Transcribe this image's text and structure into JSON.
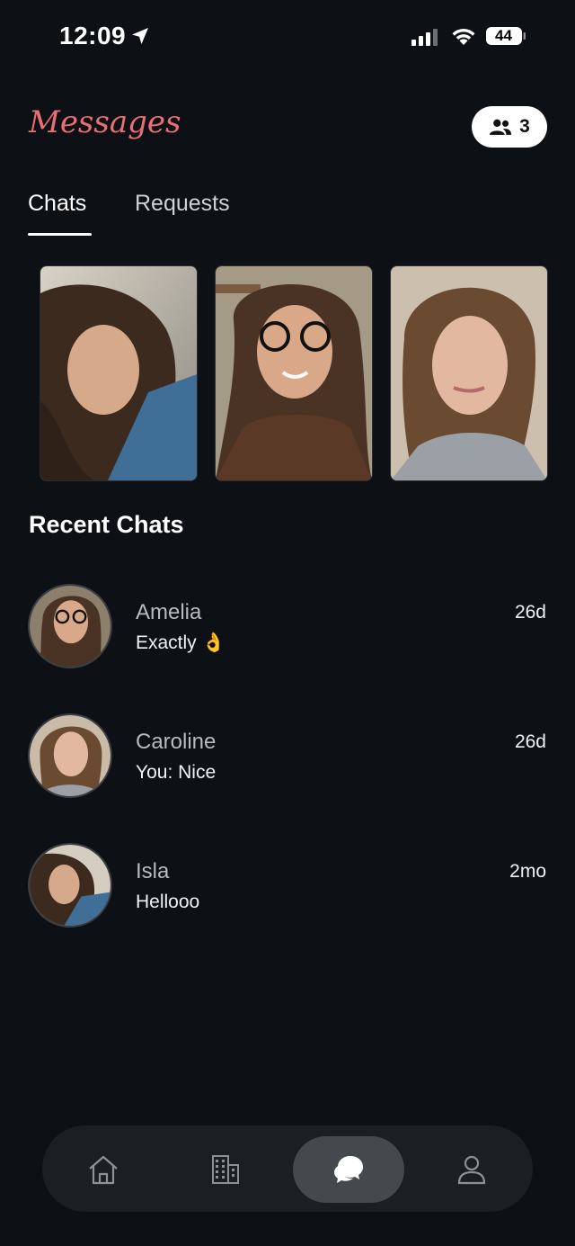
{
  "status_bar": {
    "time": "12:09",
    "battery": "44"
  },
  "header": {
    "title": "Messages",
    "online_count": "3"
  },
  "tabs": [
    {
      "label": "Chats",
      "active": true
    },
    {
      "label": "Requests",
      "active": false
    }
  ],
  "section_title": "Recent Chats",
  "chats": [
    {
      "name": "Amelia",
      "message": "Exactly 👌",
      "time": "26d"
    },
    {
      "name": "Caroline",
      "message": "You: Nice",
      "time": "26d"
    },
    {
      "name": "Isla",
      "message": "Hellooo",
      "time": "2mo"
    }
  ],
  "nav": [
    {
      "icon": "home-icon",
      "active": false
    },
    {
      "icon": "building-icon",
      "active": false
    },
    {
      "icon": "chat-bubbles-icon",
      "active": true
    },
    {
      "icon": "profile-icon",
      "active": false
    }
  ],
  "colors": {
    "background": "#0d1014",
    "accent": "#e96f74",
    "nav_bg": "#1b1e22",
    "nav_active": "#45484d"
  }
}
